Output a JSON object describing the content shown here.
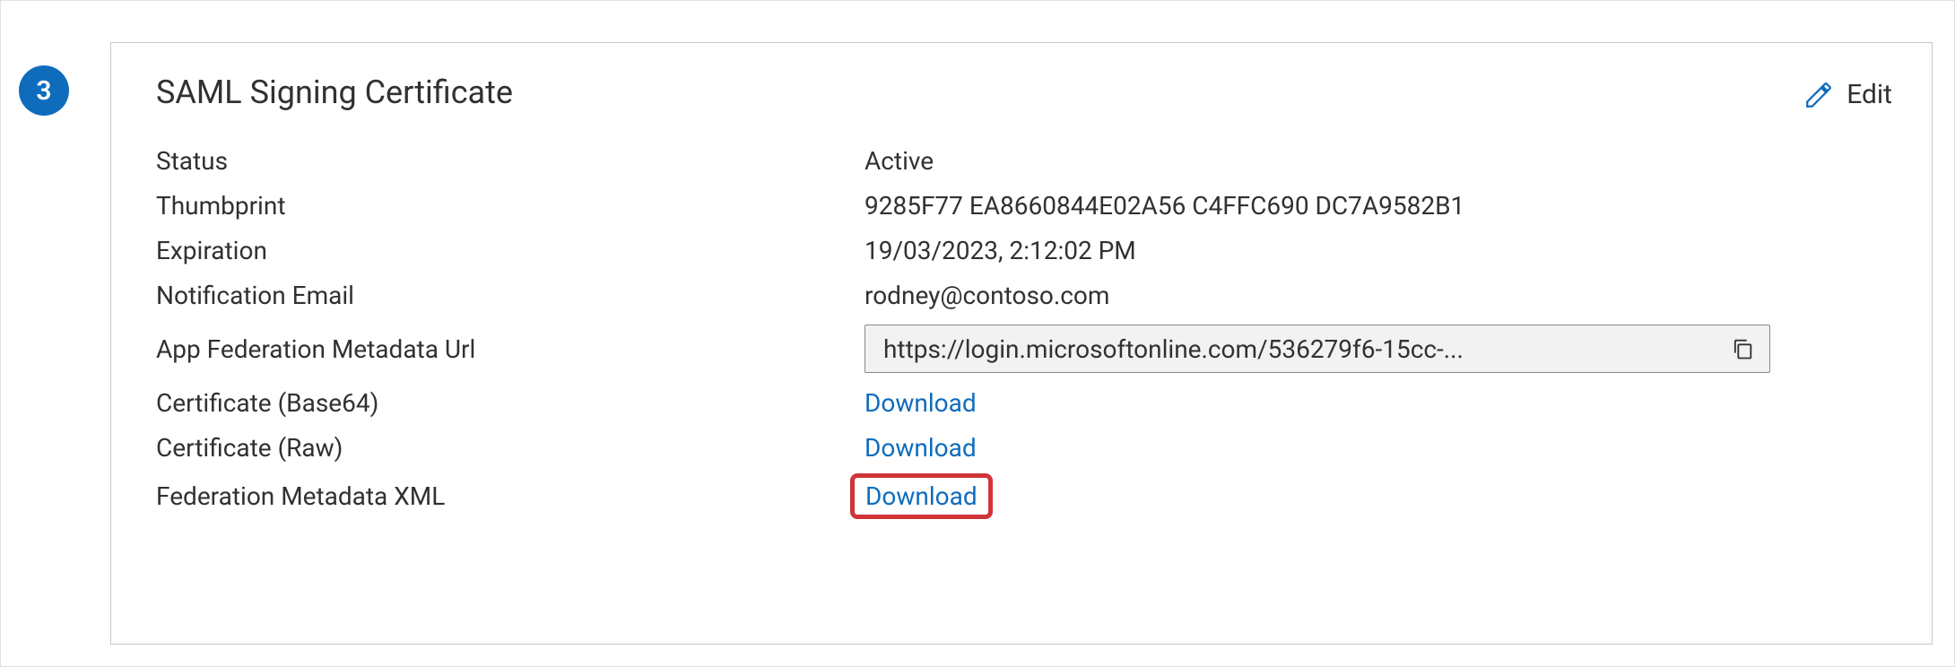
{
  "step": {
    "number": "3"
  },
  "card": {
    "title": "SAML Signing Certificate",
    "edit_label": "Edit",
    "rows": {
      "status": {
        "label": "Status",
        "value": "Active"
      },
      "thumbprint": {
        "label": "Thumbprint",
        "value": "9285F77 EA8660844E02A56 C4FFC690 DC7A9582B1"
      },
      "expiration": {
        "label": "Expiration",
        "value": "19/03/2023, 2:12:02 PM"
      },
      "notif_email": {
        "label": "Notification Email",
        "value": "rodney@contoso.com"
      },
      "fed_url": {
        "label": "App Federation Metadata Url",
        "value": "https://login.microsoftonline.com/536279f6-15cc-..."
      },
      "cert_b64": {
        "label": "Certificate (Base64)",
        "value": "Download"
      },
      "cert_raw": {
        "label": "Certificate (Raw)",
        "value": "Download"
      },
      "fed_xml": {
        "label": "Federation Metadata XML",
        "value": "Download"
      }
    }
  }
}
